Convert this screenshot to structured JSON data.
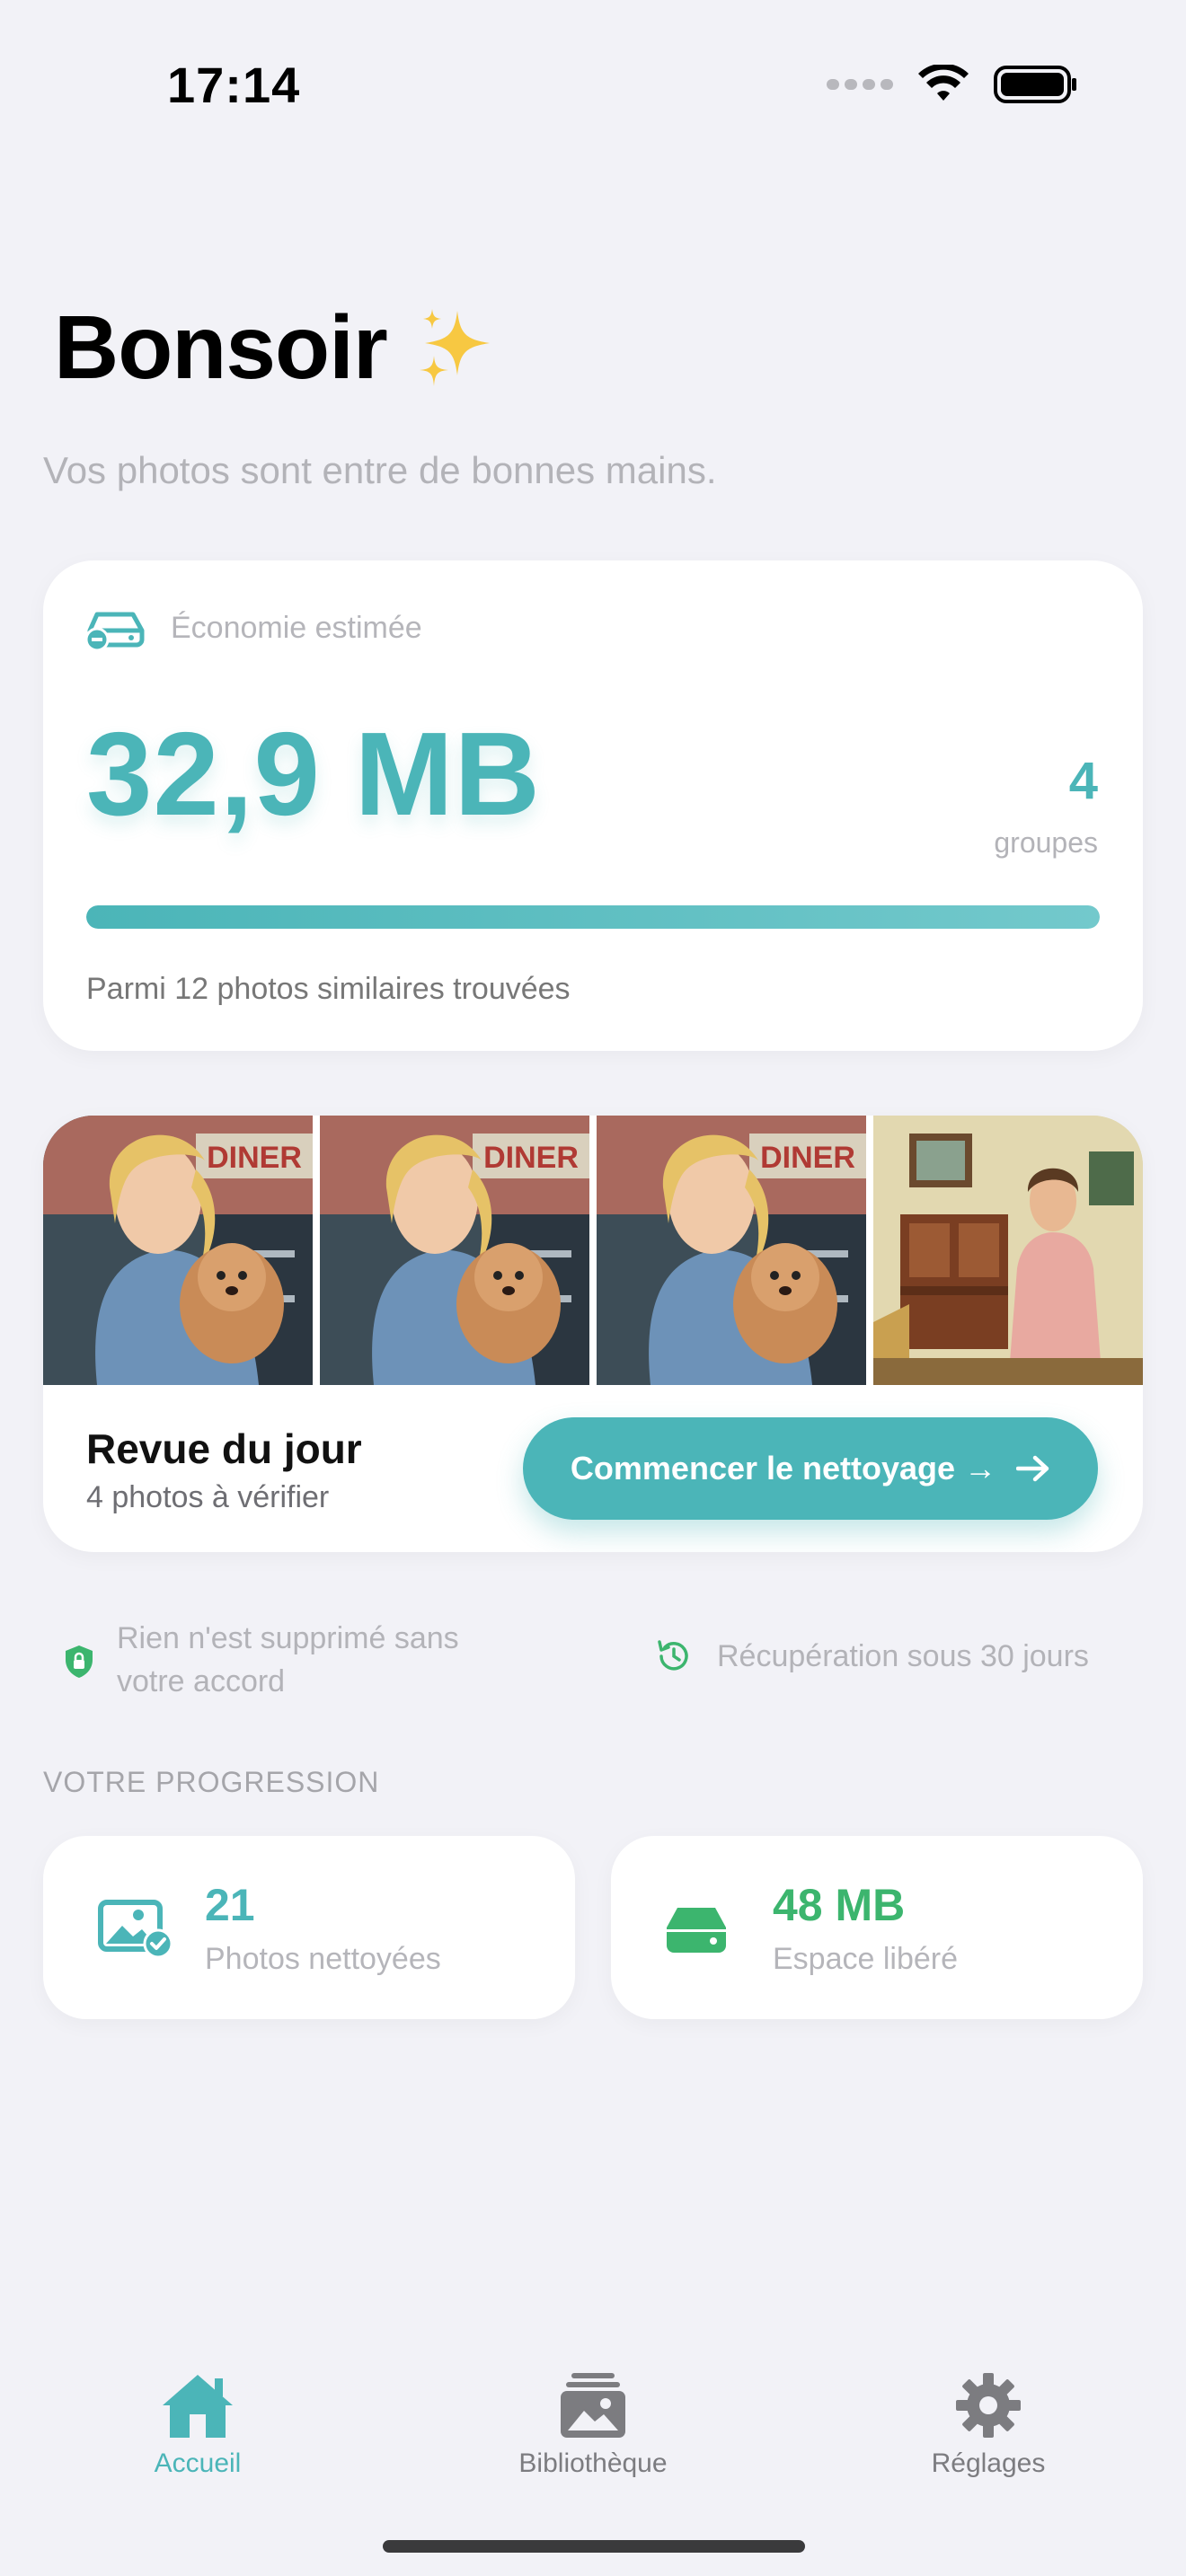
{
  "status_bar": {
    "time": "17:14"
  },
  "greeting": {
    "title": "Bonsoir",
    "subtitle": "Vos photos sont entre de bonnes mains."
  },
  "savings": {
    "label": "Économie estimée",
    "amount": "32,9 MB",
    "groups_count": "4",
    "groups_label": "groupes",
    "progress_fraction": 1.0,
    "footnote": "Parmi 12 photos similaires trouvées"
  },
  "review": {
    "title": "Revue du jour",
    "subtitle": "4 photos à vérifier",
    "button_label": "Commencer le nettoyage →",
    "sign_text": "DINER"
  },
  "assurances": {
    "left_line1": "Rien n'est supprimé sans",
    "left_line2": "votre accord",
    "right": "Récupération sous 30 jours"
  },
  "progress_section": {
    "header": "VOTRE PROGRESSION",
    "photos_value": "21",
    "photos_label": "Photos nettoyées",
    "space_value": "48 MB",
    "space_label": "Espace libéré"
  },
  "tabs": [
    {
      "label": "Accueil",
      "active": true
    },
    {
      "label": "Bibliothèque",
      "active": false
    },
    {
      "label": "Réglages",
      "active": false
    }
  ],
  "colors": {
    "accent": "#4bb5b8",
    "green": "#3cb56e",
    "tab_inactive": "#7c7c80",
    "background": "#f2f2f7"
  }
}
